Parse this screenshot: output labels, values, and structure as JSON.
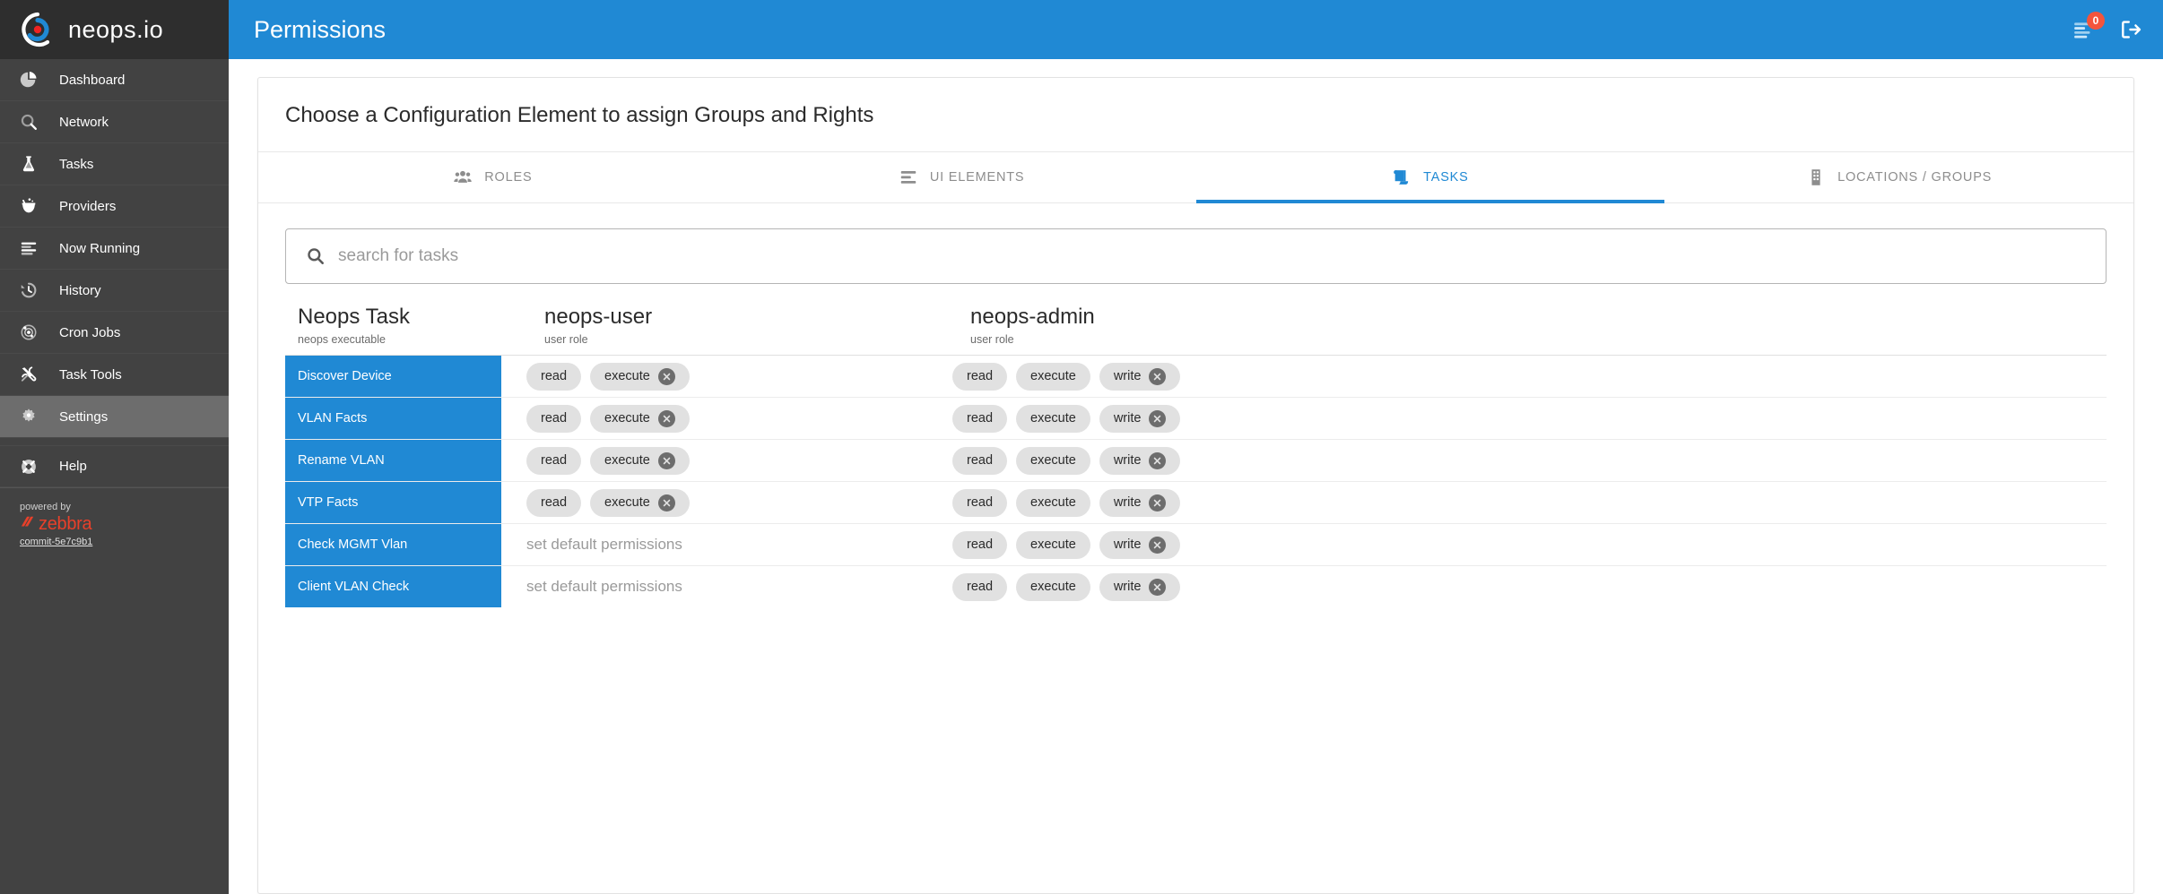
{
  "brand": {
    "name": "neops.io",
    "logo_icon": "neops-target-logo-icon"
  },
  "sidebar": {
    "items": [
      {
        "label": "Dashboard",
        "icon": "pie-chart-icon",
        "active": false
      },
      {
        "label": "Network",
        "icon": "search-icon",
        "active": false
      },
      {
        "label": "Tasks",
        "icon": "flask-icon",
        "active": false
      },
      {
        "label": "Providers",
        "icon": "cauldron-icon",
        "active": false
      },
      {
        "label": "Now Running",
        "icon": "list-lines-icon",
        "active": false
      },
      {
        "label": "History",
        "icon": "history-clock-icon",
        "active": false
      },
      {
        "label": "Cron Jobs",
        "icon": "atom-orbit-icon",
        "active": false
      },
      {
        "label": "Task Tools",
        "icon": "tools-icon",
        "active": false
      },
      {
        "label": "Settings",
        "icon": "gear-icon",
        "active": true
      }
    ],
    "help": {
      "label": "Help",
      "icon": "lifebuoy-icon"
    },
    "footer": {
      "powered_by": "powered by",
      "vendor": "zebbra",
      "commit": "commit-5e7c9b1"
    }
  },
  "header": {
    "title": "Permissions",
    "now_running_icon": "now-running-list-icon",
    "now_running_badge": "0",
    "logout_icon": "logout-icon"
  },
  "card": {
    "heading": "Choose a Configuration Element to assign Groups and Rights",
    "tabs": [
      {
        "label": "ROLES",
        "icon": "people-group-icon",
        "active": false
      },
      {
        "label": "UI ELEMENTS",
        "icon": "ui-lines-icon",
        "active": false
      },
      {
        "label": "TASKS",
        "icon": "scroll-icon",
        "active": true
      },
      {
        "label": "LOCATIONS / GROUPS",
        "icon": "building-icon",
        "active": false
      }
    ]
  },
  "search": {
    "placeholder": "search for tasks",
    "value": "",
    "icon": "search-icon"
  },
  "table": {
    "columns": [
      {
        "title": "Neops Task",
        "subtitle": "neops executable"
      },
      {
        "title": "neops-user",
        "subtitle": "user role"
      },
      {
        "title": "neops-admin",
        "subtitle": "user role"
      }
    ],
    "empty_text": "set default permissions",
    "rows": [
      {
        "task": "Discover Device",
        "user": [
          {
            "label": "read",
            "removable": false
          },
          {
            "label": "execute",
            "removable": true
          }
        ],
        "admin": [
          {
            "label": "read",
            "removable": false
          },
          {
            "label": "execute",
            "removable": false
          },
          {
            "label": "write",
            "removable": true
          }
        ]
      },
      {
        "task": "VLAN Facts",
        "user": [
          {
            "label": "read",
            "removable": false
          },
          {
            "label": "execute",
            "removable": true
          }
        ],
        "admin": [
          {
            "label": "read",
            "removable": false
          },
          {
            "label": "execute",
            "removable": false
          },
          {
            "label": "write",
            "removable": true
          }
        ]
      },
      {
        "task": "Rename VLAN",
        "user": [
          {
            "label": "read",
            "removable": false
          },
          {
            "label": "execute",
            "removable": true
          }
        ],
        "admin": [
          {
            "label": "read",
            "removable": false
          },
          {
            "label": "execute",
            "removable": false
          },
          {
            "label": "write",
            "removable": true
          }
        ]
      },
      {
        "task": "VTP Facts",
        "user": [
          {
            "label": "read",
            "removable": false
          },
          {
            "label": "execute",
            "removable": true
          }
        ],
        "admin": [
          {
            "label": "read",
            "removable": false
          },
          {
            "label": "execute",
            "removable": false
          },
          {
            "label": "write",
            "removable": true
          }
        ]
      },
      {
        "task": "Check MGMT Vlan",
        "user": [],
        "admin": [
          {
            "label": "read",
            "removable": false
          },
          {
            "label": "execute",
            "removable": false
          },
          {
            "label": "write",
            "removable": true
          }
        ]
      },
      {
        "task": "Client VLAN Check",
        "user": [],
        "admin": [
          {
            "label": "read",
            "removable": false
          },
          {
            "label": "execute",
            "removable": false
          },
          {
            "label": "write",
            "removable": true
          }
        ]
      }
    ]
  },
  "colors": {
    "accent": "#2089d4",
    "sidebar": "#424242",
    "sidebar_dark": "#2e2e2e",
    "sidebar_active": "#6d6d6d",
    "badge": "#f4543c",
    "vendor": "#e8402a",
    "pill": "#e1e1e1"
  }
}
